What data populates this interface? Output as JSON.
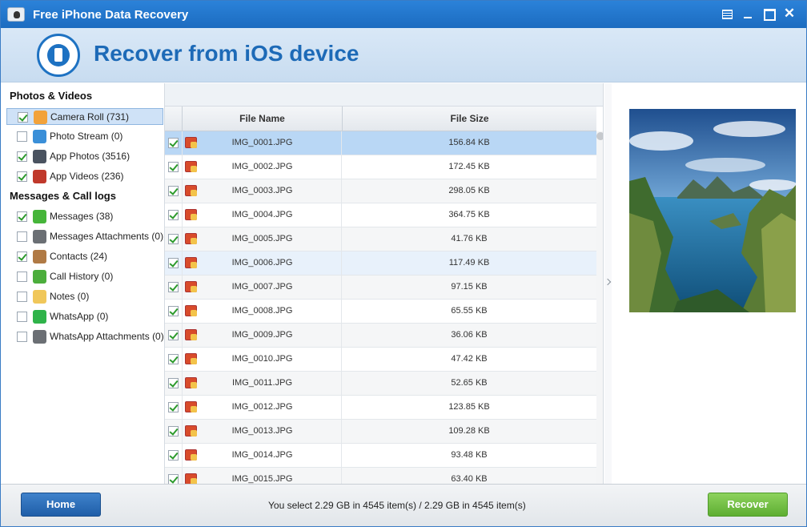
{
  "window": {
    "title": "Free iPhone Data Recovery",
    "close_glyph": "✕"
  },
  "banner": {
    "heading": "Recover from iOS device"
  },
  "sidebar": {
    "groups": [
      {
        "title": "Photos & Videos",
        "items": [
          {
            "label": "Camera Roll (731)",
            "checked": true,
            "selected": true,
            "icon": "camera-roll-icon",
            "icon_color": "#f2a23a"
          },
          {
            "label": "Photo Stream (0)",
            "checked": false,
            "icon": "photo-stream-icon",
            "icon_color": "#3a8fd8"
          },
          {
            "label": "App Photos (3516)",
            "checked": true,
            "icon": "app-photos-icon",
            "icon_color": "#4a5360"
          },
          {
            "label": "App Videos (236)",
            "checked": true,
            "icon": "app-videos-icon",
            "icon_color": "#c0392b"
          }
        ]
      },
      {
        "title": "Messages & Call logs",
        "items": [
          {
            "label": "Messages (38)",
            "checked": true,
            "icon": "messages-icon",
            "icon_color": "#46b53a"
          },
          {
            "label": "Messages Attachments (0)",
            "checked": false,
            "icon": "attachment-icon",
            "icon_color": "#6b6f74"
          },
          {
            "label": "Contacts (24)",
            "checked": true,
            "icon": "contacts-icon",
            "icon_color": "#b07a45"
          },
          {
            "label": "Call History (0)",
            "checked": false,
            "icon": "phone-icon",
            "icon_color": "#4cae3c"
          },
          {
            "label": "Notes (0)",
            "checked": false,
            "icon": "notes-icon",
            "icon_color": "#f0c75a"
          },
          {
            "label": "WhatsApp (0)",
            "checked": false,
            "icon": "whatsapp-icon",
            "icon_color": "#2fb34a"
          },
          {
            "label": "WhatsApp Attachments (0)",
            "checked": false,
            "icon": "attachment-icon",
            "icon_color": "#6b6f74"
          }
        ]
      }
    ]
  },
  "table": {
    "columns": {
      "name": "File Name",
      "size": "File Size"
    },
    "rows": [
      {
        "name": "IMG_0001.JPG",
        "size": "156.84 KB",
        "checked": true,
        "state": "selected"
      },
      {
        "name": "IMG_0002.JPG",
        "size": "172.45 KB",
        "checked": true
      },
      {
        "name": "IMG_0003.JPG",
        "size": "298.05 KB",
        "checked": true
      },
      {
        "name": "IMG_0004.JPG",
        "size": "364.75 KB",
        "checked": true
      },
      {
        "name": "IMG_0005.JPG",
        "size": "41.76 KB",
        "checked": true
      },
      {
        "name": "IMG_0006.JPG",
        "size": "117.49 KB",
        "checked": true,
        "state": "hover"
      },
      {
        "name": "IMG_0007.JPG",
        "size": "97.15 KB",
        "checked": true
      },
      {
        "name": "IMG_0008.JPG",
        "size": "65.55 KB",
        "checked": true
      },
      {
        "name": "IMG_0009.JPG",
        "size": "36.06 KB",
        "checked": true
      },
      {
        "name": "IMG_0010.JPG",
        "size": "47.42 KB",
        "checked": true
      },
      {
        "name": "IMG_0011.JPG",
        "size": "52.65 KB",
        "checked": true
      },
      {
        "name": "IMG_0012.JPG",
        "size": "123.85 KB",
        "checked": true
      },
      {
        "name": "IMG_0013.JPG",
        "size": "109.28 KB",
        "checked": true
      },
      {
        "name": "IMG_0014.JPG",
        "size": "93.48 KB",
        "checked": true
      },
      {
        "name": "IMG_0015.JPG",
        "size": "63.40 KB",
        "checked": true
      }
    ]
  },
  "footer": {
    "home_label": "Home",
    "status": "You select 2.29 GB in 4545 item(s) / 2.29 GB in 4545 item(s)",
    "recover_label": "Recover"
  },
  "colors": {
    "titlebar": "#1f72c6",
    "heading": "#1d6ab7",
    "home_button": "#2a6cb8",
    "recover_button": "#6cbc3e",
    "selected_row": "#b9d7f5"
  }
}
